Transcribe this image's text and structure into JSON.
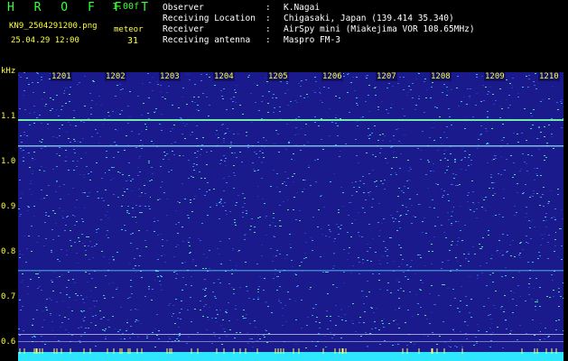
{
  "header": {
    "app_name": "H R O F F T",
    "version": "1.00f",
    "filename": "KN9_2504291200.png",
    "meteor_label": "meteor",
    "date": "25.04.29 12:00",
    "meteor_count": "31",
    "info": [
      {
        "key": "Observer",
        "value": "K.Nagai"
      },
      {
        "key": "Receiving Location",
        "value": "Chigasaki, Japan (139.414 35.340)"
      },
      {
        "key": "Receiver",
        "value": "AirSpy mini (Miakejima VOR 108.65MHz)"
      },
      {
        "key": "Receiving antenna",
        "value": "Maspro FM-3"
      }
    ]
  },
  "plot": {
    "unit_label": "kHz",
    "y_labels": [
      "1.1",
      "1.0",
      "0.9",
      "0.8",
      "0.7",
      "0.6"
    ],
    "x_labels": [
      "1201",
      "1202",
      "1203",
      "1204",
      "1205",
      "1206",
      "1207",
      "1208",
      "1209",
      "1210"
    ],
    "colors": {
      "background": "#1a1a8c",
      "axis_text": "#ffff3a",
      "logo": "#3cff3c",
      "cyan": "#2ee6ff"
    }
  }
}
